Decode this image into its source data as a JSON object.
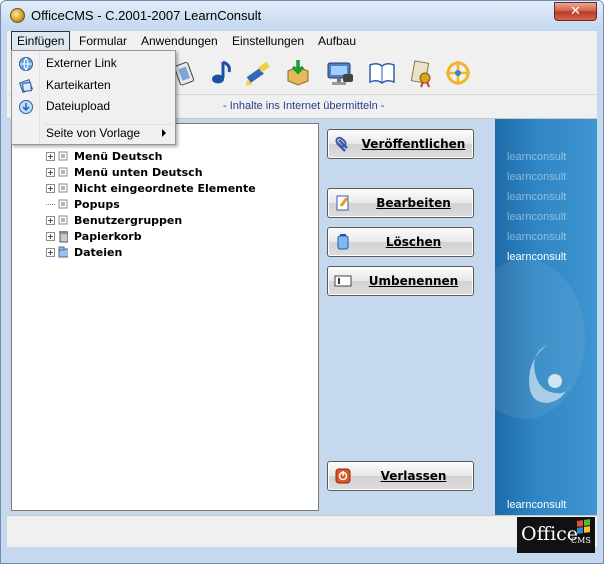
{
  "window": {
    "title": "OfficeCMS - C.2001-2007 LearnConsult",
    "close_label": "✕"
  },
  "menubar": [
    {
      "label": "Einfügen",
      "name": "menu-einfuegen"
    },
    {
      "label": "Formular",
      "name": "menu-formular"
    },
    {
      "label": "Anwendungen",
      "name": "menu-anwendungen"
    },
    {
      "label": "Einstellungen",
      "name": "menu-einstellungen"
    },
    {
      "label": "Aufbau",
      "name": "menu-aufbau"
    }
  ],
  "dropdown": {
    "items": [
      {
        "label": "Externer Link",
        "icon": "globe-link-icon"
      },
      {
        "label": "Karteikarten",
        "icon": "cards-icon"
      },
      {
        "label": "Dateiupload",
        "icon": "upload-icon"
      }
    ],
    "template_label": "Seite von Vorlage"
  },
  "toolbar": {
    "icons": [
      "film-icon",
      "music-note-icon",
      "brush-icon",
      "package-download-icon",
      "monitor-camera-icon",
      "book-icon",
      "certificate-icon",
      "compass-icon"
    ]
  },
  "hint": "- Inhalte ins Internet übermitteln -",
  "tree": [
    {
      "label": "Menü Deutsch",
      "expandable": true,
      "icon": "page-icon"
    },
    {
      "label": "Menü unten Deutsch",
      "expandable": true,
      "icon": "page-icon"
    },
    {
      "label": "Nicht eingeordnete Elemente",
      "expandable": true,
      "icon": "page-icon"
    },
    {
      "label": "Popups",
      "expandable": false,
      "icon": "page-icon"
    },
    {
      "label": "Benutzergruppen",
      "expandable": true,
      "icon": "page-icon"
    },
    {
      "label": "Papierkorb",
      "expandable": true,
      "icon": "trash-icon"
    },
    {
      "label": "Dateien",
      "expandable": true,
      "icon": "folder-icon"
    }
  ],
  "actions": {
    "publish": "Veröffentlichen",
    "edit": "Bearbeiten",
    "delete": "Löschen",
    "rename": "Umbenennen",
    "quit": "Verlassen"
  },
  "brand": {
    "lines": [
      "learnconsult",
      "learnconsult",
      "learnconsult",
      "learnconsult",
      "learnconsult",
      "learnconsult"
    ],
    "bottom": "learnconsult",
    "office_logo": "Office",
    "office_sub": "CMS"
  },
  "colors": {
    "accent": "#2b3e8c",
    "brand_blue": "#2f86c4"
  }
}
